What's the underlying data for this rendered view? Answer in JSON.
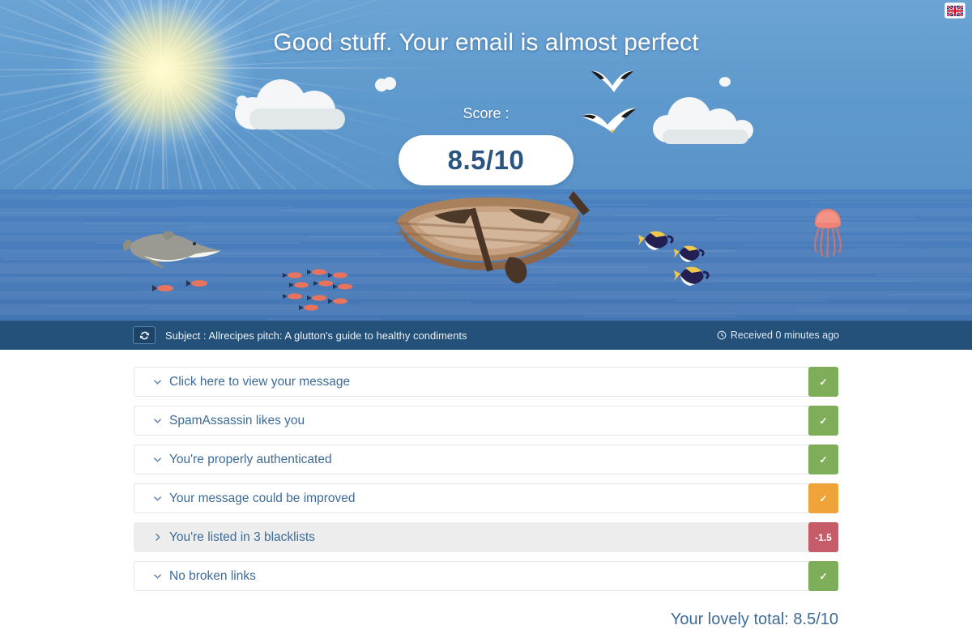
{
  "hero": {
    "title": "Good stuff. Your email is almost perfect",
    "score_label": "Score :",
    "score_value": "8.5/10"
  },
  "lang": {
    "name": "uk-flag-icon",
    "title": "English"
  },
  "subject_bar": {
    "refresh_icon": "refresh-icon",
    "subject": "Subject : Allrecipes pitch: A glutton's guide to healthy condiments",
    "clock_icon": "clock-icon",
    "received": "Received 0 minutes ago"
  },
  "results": [
    {
      "label": "Click here to view your message",
      "chevron": "chevron-down-icon",
      "expanded": false,
      "badge": "✓",
      "badge_type": "ok",
      "highlight": false
    },
    {
      "label": "SpamAssassin likes you",
      "chevron": "chevron-down-icon",
      "expanded": false,
      "badge": "✓",
      "badge_type": "ok",
      "highlight": false
    },
    {
      "label": "You're properly authenticated",
      "chevron": "chevron-down-icon",
      "expanded": false,
      "badge": "✓",
      "badge_type": "ok",
      "highlight": false
    },
    {
      "label": "Your message could be improved",
      "chevron": "chevron-down-icon",
      "expanded": false,
      "badge": "✓",
      "badge_type": "warn",
      "highlight": false
    },
    {
      "label": "You're listed in 3 blacklists",
      "chevron": "chevron-right-icon",
      "expanded": false,
      "badge": "-1.5",
      "badge_type": "bad",
      "highlight": true
    },
    {
      "label": "No broken links",
      "chevron": "chevron-down-icon",
      "expanded": false,
      "badge": "✓",
      "badge_type": "ok",
      "highlight": false
    }
  ],
  "footer": {
    "total": "Your lovely total: 8.5/10"
  },
  "colors": {
    "sky": "#5e99cd",
    "sea": "#4a7cbb",
    "bar": "#245179",
    "accent_text": "#3d6b97",
    "ok": "#7eae59",
    "warn": "#f0a338",
    "bad": "#c65c68",
    "score_text": "#2a5580"
  },
  "scene": {
    "sun": "sun-icon",
    "clouds": [
      "cloud-icon",
      "cloud-icon",
      "cloud-icon"
    ],
    "gulls": [
      "seagull-icon",
      "seagull-icon"
    ],
    "boat": "rowboat-icon",
    "dolphin": "dolphin-icon",
    "fish_school": "fish-school-icon",
    "tang_fish": [
      "tang-fish-icon",
      "tang-fish-icon",
      "tang-fish-icon"
    ],
    "jellyfish": "jellyfish-icon"
  }
}
